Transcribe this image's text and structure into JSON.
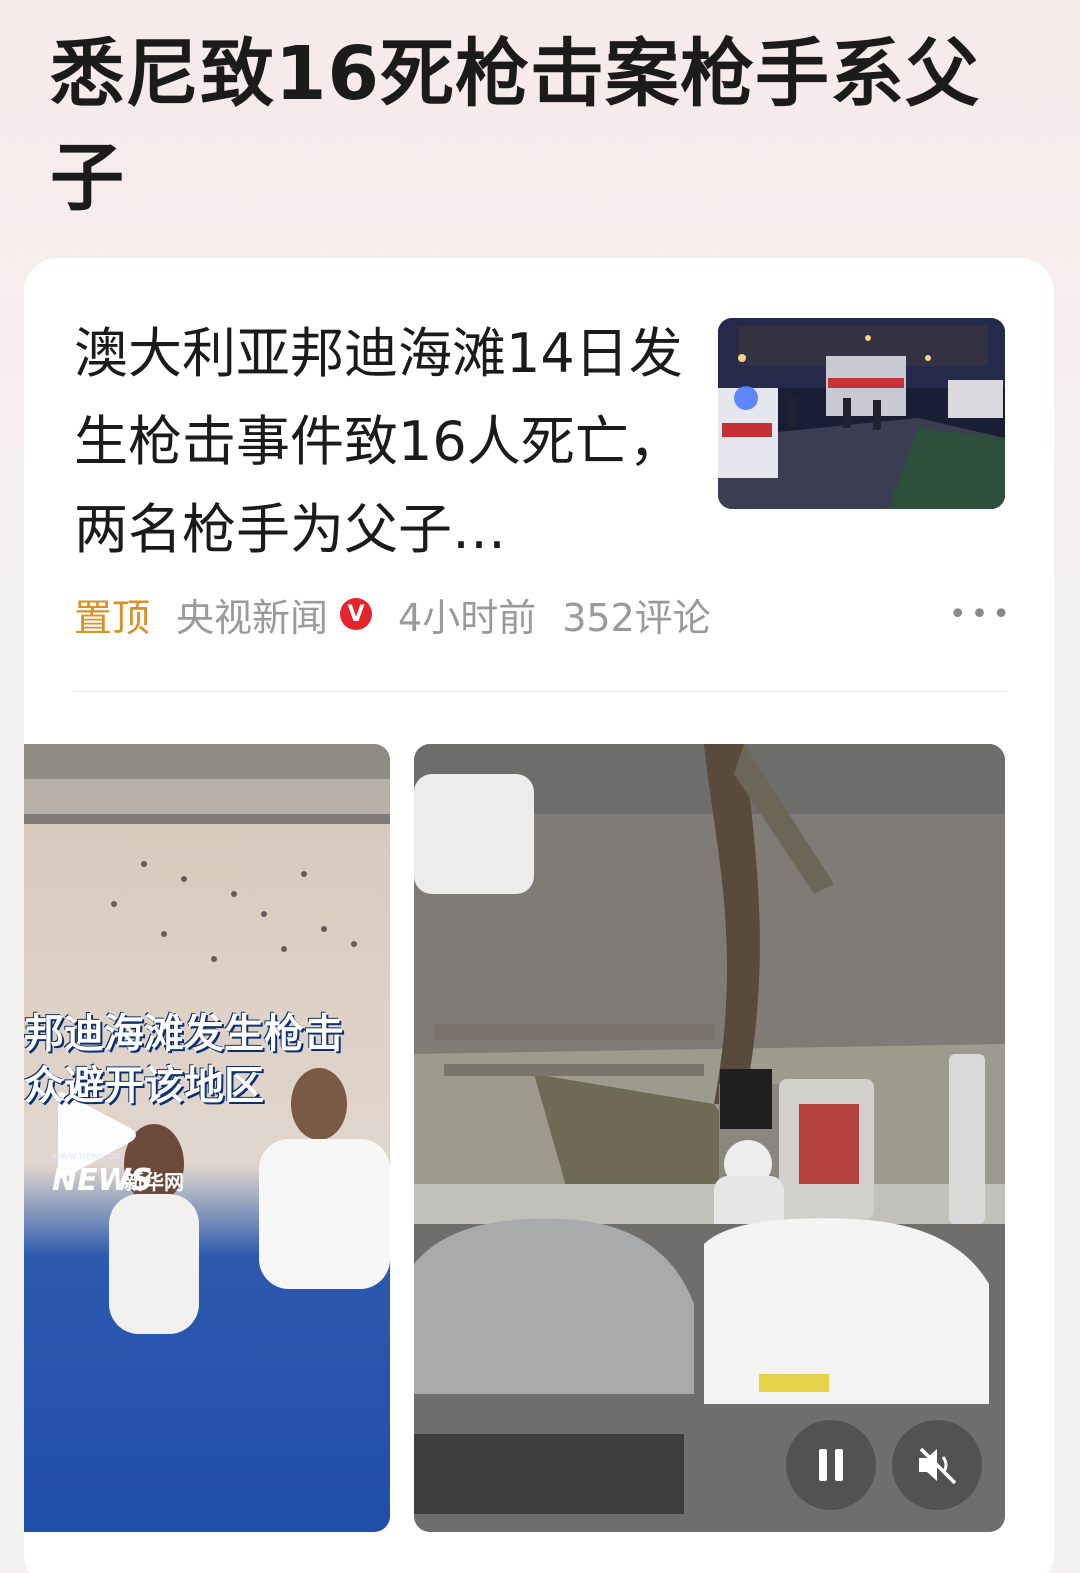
{
  "topic": {
    "title": "悉尼致16死枪击案枪手系父子"
  },
  "article": {
    "headline": "澳大利亚邦迪海滩14日发生枪击事件致16人死亡，两名枪手为父子…",
    "pin_label": "置顶",
    "source": "央视新闻",
    "verified_badge": "V",
    "time": "4小时前",
    "comments": "352评论",
    "more": "•••"
  },
  "video_left": {
    "caption_line1": "邦迪海滩发生枪击",
    "caption_line2": "众避开该地区",
    "watermark_site": "www.news.cn",
    "watermark_logo": "NEWS",
    "watermark_cn": "新华网",
    "play_icon": "play-icon"
  },
  "video_right": {
    "pause_icon": "pause-icon",
    "mute_icon": "speaker-muted-icon"
  }
}
